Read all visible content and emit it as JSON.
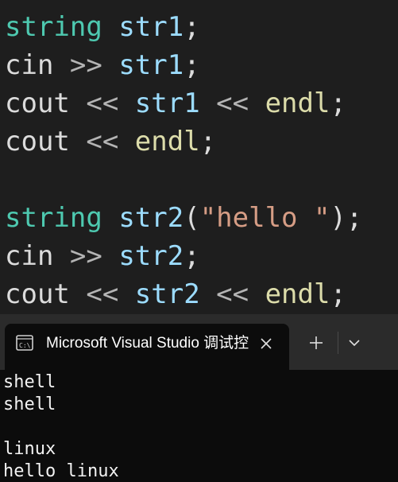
{
  "editor": {
    "lines": [
      {
        "tokens": [
          "string",
          " ",
          "str1",
          ";"
        ]
      },
      {
        "tokens": [
          "cin",
          " >> ",
          "str1",
          ";"
        ]
      },
      {
        "tokens": [
          "cout",
          " << ",
          "str1",
          " << ",
          "endl",
          ";"
        ]
      },
      {
        "tokens": [
          "cout",
          " << ",
          "endl",
          ";"
        ]
      },
      {
        "tokens": []
      },
      {
        "tokens": [
          "string",
          " ",
          "str2",
          "(",
          "\"hello \"",
          ");"
        ]
      },
      {
        "tokens": [
          "cin",
          " >> ",
          "str2",
          ";"
        ]
      },
      {
        "tokens": [
          "cout",
          " << ",
          "str2",
          " << ",
          "endl",
          ";"
        ]
      }
    ]
  },
  "terminal": {
    "tab_icon": "console-icon",
    "tab_title": "Microsoft Visual Studio 调试控",
    "close_icon": "close-icon",
    "new_tab_label": "+",
    "dropdown_icon": "chevron-down-icon",
    "output": [
      "shell",
      "shell",
      "",
      "linux",
      "hello linux"
    ]
  },
  "colors": {
    "editor_bg": "#1e1e1e",
    "type": "#4ec9b0",
    "variable": "#9cdcfe",
    "function": "#dcdcaa",
    "string": "#d69d85",
    "plain": "#dcdcdc",
    "terminal_bg": "#0c0c0c",
    "tabbar_bg": "#2b2b2b",
    "terminal_text": "#f2f2f2"
  }
}
